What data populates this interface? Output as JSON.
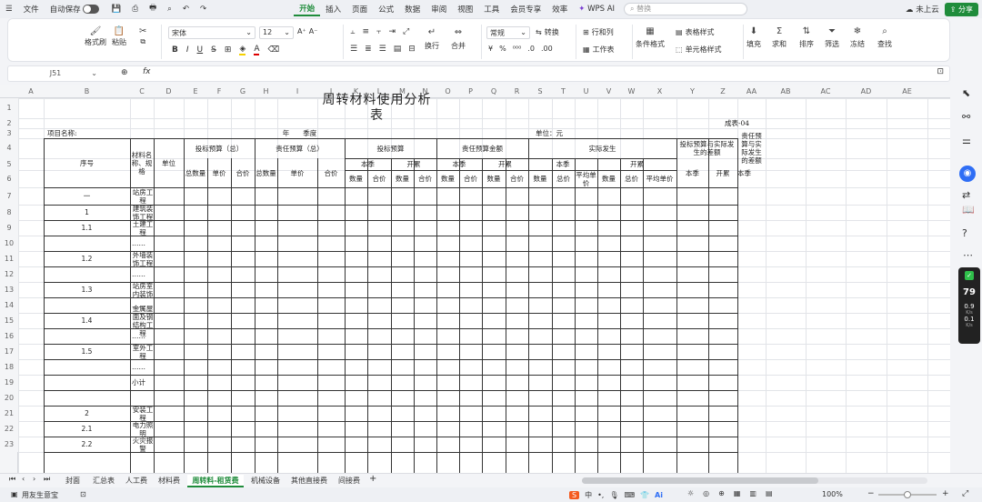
{
  "menu": {
    "file": "文件",
    "autosave": "自动保存",
    "tabs": [
      "开始",
      "插入",
      "页面",
      "公式",
      "数据",
      "审阅",
      "视图",
      "工具",
      "会员专享",
      "效率"
    ],
    "wps_ai": "WPS AI",
    "search_placeholder": "替换",
    "cloud": "未上云",
    "share": "分享"
  },
  "ribbon": {
    "format_painter": "格式刷",
    "paste": "粘贴",
    "cut": "剪切",
    "font_name": "宋体",
    "font_size": "12",
    "bold": "B",
    "italic": "I",
    "underline": "U",
    "wrap": "换行",
    "merge": "合并",
    "number_format": "常规",
    "convert": "转换",
    "rows_cols": "行和列",
    "worksheet": "工作表",
    "cond_format": "条件格式",
    "table_style": "表格样式",
    "cell_style": "单元格样式",
    "fill": "填充",
    "sum": "求和",
    "sort": "排序",
    "filter": "筛选",
    "freeze": "冻结",
    "find": "查找",
    "percent": "%"
  },
  "formula_bar": {
    "name_box": "J51",
    "fx": "fx"
  },
  "columns": [
    "A",
    "B",
    "C",
    "D",
    "E",
    "F",
    "G",
    "H",
    "I",
    "J",
    "K",
    "L",
    "M",
    "N",
    "O",
    "P",
    "Q",
    "R",
    "S",
    "T",
    "U",
    "V",
    "W",
    "X",
    "Y",
    "Z",
    "AA",
    "AB",
    "AC",
    "AD",
    "AE"
  ],
  "rows": [
    "1",
    "2",
    "3",
    "4",
    "5",
    "6",
    "7",
    "8",
    "9",
    "10",
    "11",
    "12",
    "13",
    "14",
    "15",
    "16",
    "17",
    "18",
    "19",
    "20",
    "21",
    "22",
    "23"
  ],
  "sheet": {
    "title": "周转材料使用分析表",
    "form_no": "成表-04",
    "project_label": "项目名称:",
    "year_quarter": "年　　季度",
    "unit_label": "单位：元",
    "h_seq": "序号",
    "h_name": "材料名称、规格",
    "h_unit": "单位",
    "h_bid_total": "投标预算（总）",
    "h_resp_total": "责任预算（总）",
    "h_bid": "投标预算",
    "h_resp_amt": "责任预算金额",
    "h_actual": "实际发生",
    "h_diff_bid": "投标预算与实际发生的差额",
    "h_diff_resp": "责任预算与实际发生的差额",
    "h_total_qty": "总数量",
    "h_unit_price": "单价",
    "h_total_price": "合价",
    "h_season": "本季",
    "h_cum": "开累",
    "h_qty": "数量",
    "h_hj": "合价",
    "h_zj": "总价",
    "h_avg": "平均单价",
    "rows": [
      {
        "seq": "一",
        "name": "站房工程"
      },
      {
        "seq": "1",
        "name": "建筑装饰工程"
      },
      {
        "seq": "1.1",
        "name": "土建工程"
      },
      {
        "seq": "",
        "name": "……"
      },
      {
        "seq": "1.2",
        "name": "外墙装饰工程"
      },
      {
        "seq": "",
        "name": "……"
      },
      {
        "seq": "1.3",
        "name": "站房室内装饰"
      },
      {
        "seq": "",
        "name": "……"
      },
      {
        "seq": "1.4",
        "name": "金属屋面及钢结构工程"
      },
      {
        "seq": "",
        "name": "……"
      },
      {
        "seq": "1.5",
        "name": "室外工程"
      },
      {
        "seq": "",
        "name": "……"
      },
      {
        "seq": "",
        "name": "小计"
      },
      {
        "seq": "",
        "name": ""
      },
      {
        "seq": "2",
        "name": "安装工程"
      },
      {
        "seq": "2.1",
        "name": "电力照明"
      },
      {
        "seq": "2.2",
        "name": "火灾报警"
      }
    ]
  },
  "sheet_tabs": [
    "封面",
    "汇总表",
    "人工费",
    "材料费",
    "周转料-租赁费",
    "机械设备",
    "其他直接费",
    "间接费"
  ],
  "active_tab": "周转料-租赁费",
  "status": {
    "app": "用友生意宝",
    "zoom": "100%"
  },
  "side_badge": {
    "percent": "79",
    "up": "0.9",
    "down": "0.1",
    "unit": "K/s"
  },
  "colors": {
    "accent": "#1f8c3b",
    "active_tab": "#1f8c3b",
    "grid": "#333333"
  }
}
